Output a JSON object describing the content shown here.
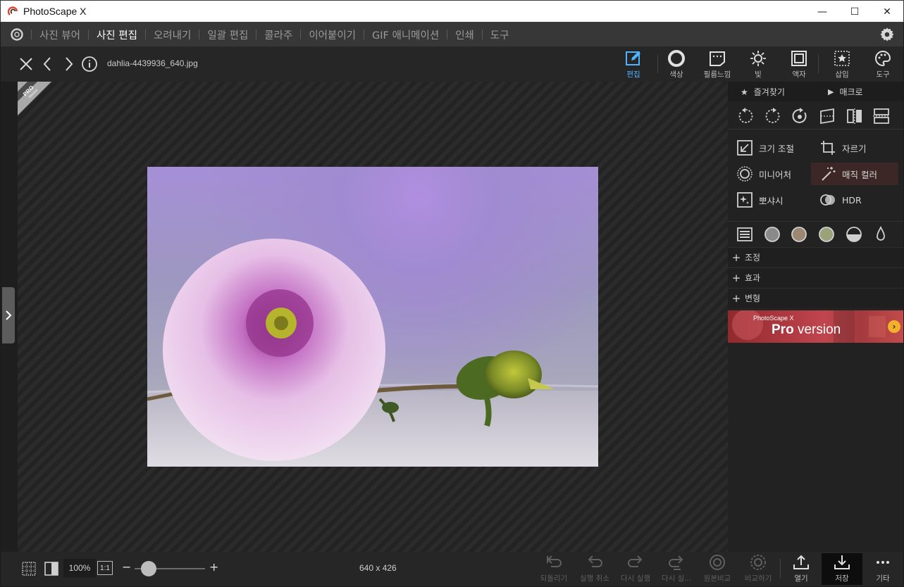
{
  "window": {
    "title": "PhotoScape X",
    "minimize": "—",
    "maximize": "☐",
    "close": "✕"
  },
  "menu": {
    "tabs": [
      {
        "label": "사진 뷰어"
      },
      {
        "label": "사진 편집"
      },
      {
        "label": "오려내기"
      },
      {
        "label": "일괄 편집"
      },
      {
        "label": "콜라주"
      },
      {
        "label": "이어붙이기"
      },
      {
        "label": "GIF 애니메이션"
      },
      {
        "label": "인쇄"
      },
      {
        "label": "도구"
      }
    ]
  },
  "toolbar": {
    "filename": "dahlia-4439936_640.jpg",
    "tools": [
      {
        "label": "편집",
        "icon": "pencil-edit-icon"
      },
      {
        "label": "색상",
        "icon": "color-circle-icon"
      },
      {
        "label": "필름느낌",
        "icon": "film-icon"
      },
      {
        "label": "빛",
        "icon": "sun-icon"
      },
      {
        "label": "액자",
        "icon": "frame-icon"
      },
      {
        "label": "삽입",
        "icon": "insert-star-icon"
      },
      {
        "label": "도구",
        "icon": "palette-icon"
      }
    ]
  },
  "badge": {
    "pro": "PRO",
    "version": "Version"
  },
  "right_panel": {
    "favorites": "즐겨찾기",
    "macro": "매크로",
    "functions": [
      {
        "label": "크기 조절",
        "icon": "resize-icon"
      },
      {
        "label": "자르기",
        "icon": "crop-icon"
      },
      {
        "label": "미니어처",
        "icon": "miniature-icon"
      },
      {
        "label": "매직 컬러",
        "icon": "magic-wand-icon"
      },
      {
        "label": "뽀샤시",
        "icon": "sparkle-icon"
      },
      {
        "label": "HDR",
        "icon": "hdr-icon"
      }
    ],
    "sections": [
      {
        "label": "조정"
      },
      {
        "label": "효과"
      },
      {
        "label": "변형"
      }
    ],
    "banner_small": "PhotoScape X",
    "banner_pro": "Pro",
    "banner_version": " version"
  },
  "bottom": {
    "zoom": "100%",
    "one_to_one": "1:1",
    "minus": "−",
    "plus": "+",
    "zoom_level": 0.2,
    "dimensions": "640 x 426",
    "actions": [
      {
        "label": "되돌리기",
        "enabled": false
      },
      {
        "label": "실행 취소",
        "enabled": false
      },
      {
        "label": "다시 실행",
        "enabled": false
      },
      {
        "label": "다시 실...",
        "enabled": false
      },
      {
        "label": "원본비교",
        "enabled": false
      },
      {
        "label": "비교하기",
        "enabled": false
      },
      {
        "label": "열기",
        "enabled": true
      },
      {
        "label": "저장",
        "enabled": true
      },
      {
        "label": "기타",
        "enabled": true
      }
    ]
  },
  "colors": {
    "accent": "#4fb3ff",
    "menubar": "#373737",
    "panel": "#222222"
  }
}
